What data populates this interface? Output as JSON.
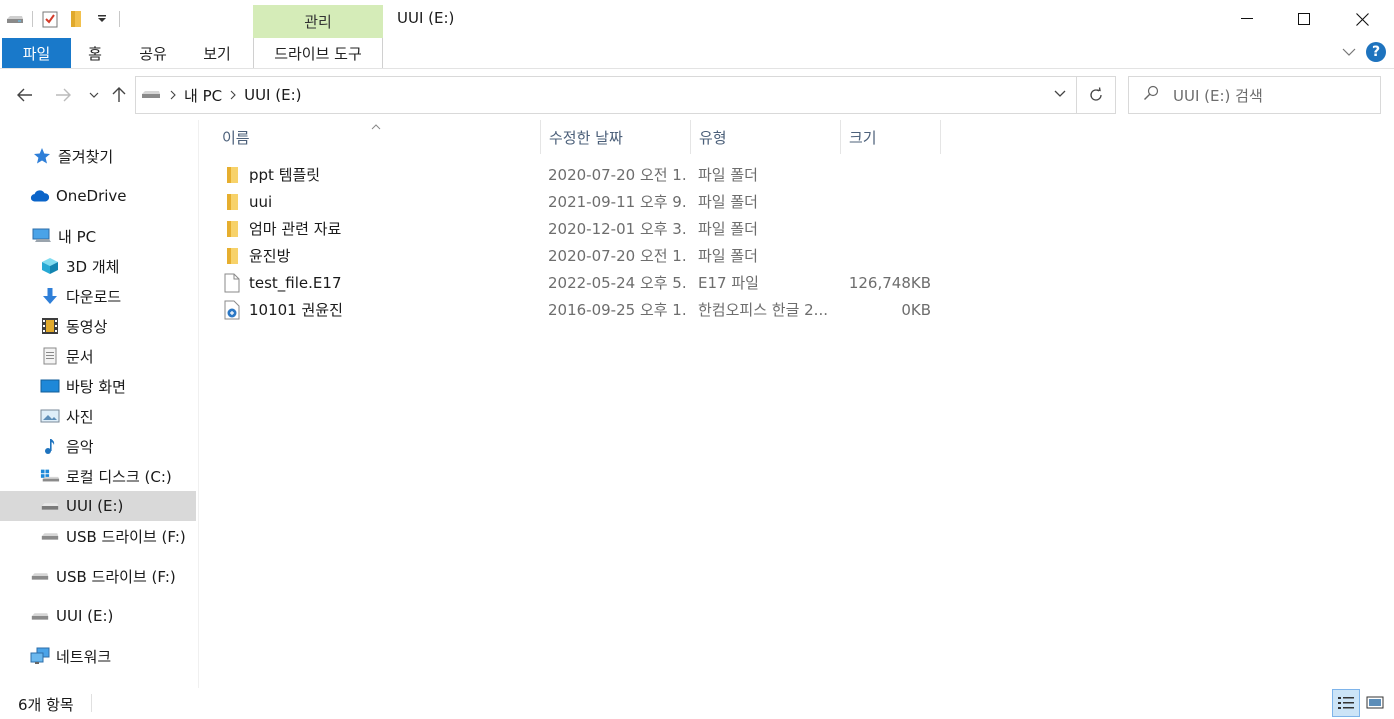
{
  "window": {
    "title": "UUI (E:)",
    "context_tab": "관리",
    "minimize_icon": "minimize-icon",
    "maximize_icon": "maximize-icon",
    "close_icon": "close-icon"
  },
  "ribbon": {
    "tabs": [
      "파일",
      "홈",
      "공유",
      "보기"
    ],
    "context_tab_label": "드라이브 도구",
    "help_label": "?"
  },
  "address": {
    "crumbs": [
      "내 PC",
      "UUI (E:)"
    ],
    "search_placeholder": "UUI (E:) 검색"
  },
  "sidebar": {
    "quick_access": "즐겨찾기",
    "onedrive": "OneDrive",
    "this_pc": "내 PC",
    "pc_items": [
      "3D 개체",
      "다운로드",
      "동영상",
      "문서",
      "바탕 화면",
      "사진",
      "음악",
      "로컬 디스크 (C:)",
      "UUI (E:)",
      "USB 드라이브 (F:)"
    ],
    "usb_root": "USB 드라이브 (F:)",
    "uui_root": "UUI (E:)",
    "network": "네트워크"
  },
  "columns": {
    "name": "이름",
    "date": "수정한 날짜",
    "type": "유형",
    "size": "크기"
  },
  "files": [
    {
      "name": "ppt 템플릿",
      "date": "2020-07-20 오전 1...",
      "type": "파일 폴더",
      "size": "",
      "icon": "folder-icon"
    },
    {
      "name": "uui",
      "date": "2021-09-11 오후 9...",
      "type": "파일 폴더",
      "size": "",
      "icon": "folder-icon"
    },
    {
      "name": "엄마 관련 자료",
      "date": "2020-12-01 오후 3...",
      "type": "파일 폴더",
      "size": "",
      "icon": "folder-icon"
    },
    {
      "name": "윤진방",
      "date": "2020-07-20 오전 1...",
      "type": "파일 폴더",
      "size": "",
      "icon": "folder-icon"
    },
    {
      "name": "test_file.E17",
      "date": "2022-05-24 오후 5...",
      "type": "E17 파일",
      "size": "126,748KB",
      "icon": "blank-file-icon"
    },
    {
      "name": "10101 권윤진",
      "date": "2016-09-25 오후 1...",
      "type": "한컴오피스 한글 2...",
      "size": "0KB",
      "icon": "hwp-document-icon"
    }
  ],
  "status": {
    "item_count": "6개 항목"
  },
  "colors": {
    "accent": "#1979ca",
    "context_tab_bg": "#d5ecb8",
    "selection": "#d9d9d9",
    "folder": "#f2c14e"
  }
}
